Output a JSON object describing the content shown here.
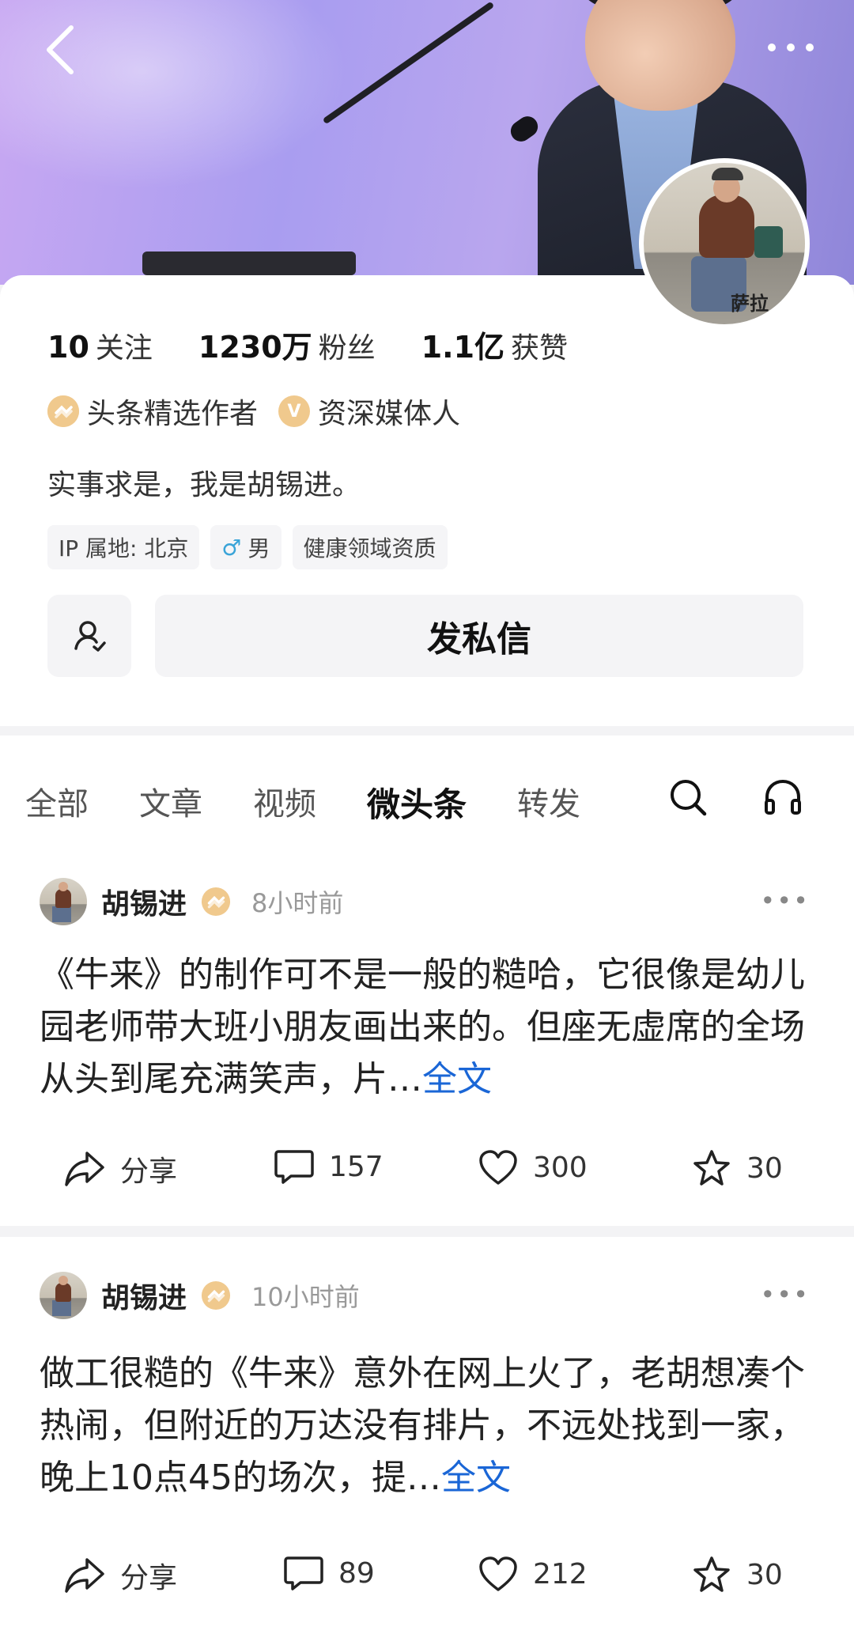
{
  "header": {
    "back_icon": "chevron-left-icon",
    "more_icon": "more-horizontal-icon"
  },
  "profile": {
    "avatar_signature": "萨拉",
    "stats": [
      {
        "num": "10",
        "label": "关注"
      },
      {
        "num": "1230万",
        "label": "粉丝"
      },
      {
        "num": "1.1亿",
        "label": "获赞"
      }
    ],
    "badges": [
      {
        "icon_text": "",
        "label": "头条精选作者"
      },
      {
        "icon_text": "V",
        "label": "资深媒体人"
      }
    ],
    "bio": "实事求是，我是胡锡进。",
    "tags": {
      "ip": "IP 属地: 北京",
      "gender": "男",
      "qualification": "健康领域资质"
    },
    "message_button": "发私信"
  },
  "tabs": [
    "全部",
    "文章",
    "视频",
    "微头条",
    "转发"
  ],
  "active_tab": "微头条",
  "posts": [
    {
      "author": "胡锡进",
      "time": "8小时前",
      "text": "《牛来》的制作可不是一般的糙哈，它很像是幼儿园老师带大班小朋友画出来的。但座无虚席的全场从头到尾充满笑声，片…",
      "full_text_link": "全文",
      "share": "分享",
      "comments": "157",
      "likes": "300",
      "favorites": "30"
    },
    {
      "author": "胡锡进",
      "time": "10小时前",
      "text": "做工很糙的《牛来》意外在网上火了，老胡想凑个热闹，但附近的万达没有排片，不远处找到一家，晚上10点45的场次，提…",
      "full_text_link": "全文",
      "share": "分享",
      "comments": "89",
      "likes": "212",
      "favorites": "30"
    }
  ],
  "colors": {
    "accent_link": "#1a66d6",
    "badge_gold": "#f0c98d",
    "banner_purple": "#b9a6ee"
  }
}
